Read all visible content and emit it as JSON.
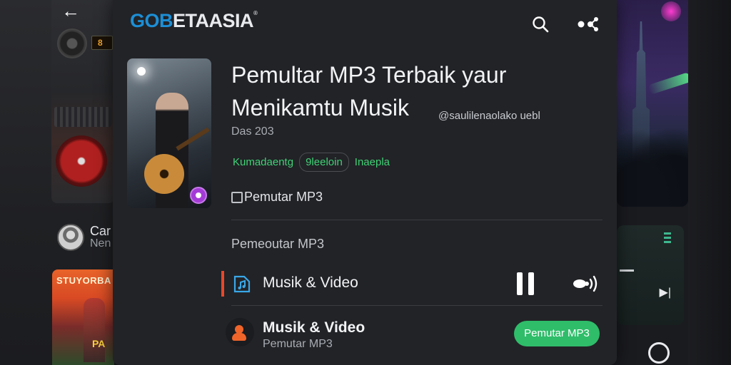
{
  "header": {
    "brand_part1": "GOB",
    "brand_part2": "ETAASIA",
    "brand_reg": "®"
  },
  "track": {
    "title_line1": "Pemultar MP3 Terbaik yaur",
    "title_line2": "Menikamtu Musik",
    "handle": "@saulilenaolako uebl",
    "date": "Das 203",
    "tags": [
      "Kumadaentg",
      "9leeloin",
      "Inaepla"
    ],
    "subtitle": "Pemutar MP3"
  },
  "section": {
    "label": "Pemeoutar MP3"
  },
  "now_playing": {
    "label": "Musik & Video",
    "state": "playing"
  },
  "list_item": {
    "title": "Musik & Video",
    "subtitle": "Pemutar MP3",
    "cta": "Pemutar MP3"
  },
  "left_preview": {
    "name": "Car",
    "sub": "Nen",
    "poster_title": "STUYORBA",
    "poster_badge": "PA"
  },
  "icons": {
    "back": "back-arrow-icon",
    "search": "search-icon",
    "share": "share-icon",
    "cover_badge": "sound-badge-icon",
    "doc": "document-icon",
    "music_video": "music-file-icon",
    "pause": "pause-icon",
    "cast": "cast-icon",
    "user": "user-icon"
  },
  "colors": {
    "brand_blue": "#1c8fd6",
    "accent_green": "#2fbd6a",
    "tag_green": "#3fd275",
    "active_accent": "#e8482a",
    "panel_bg": "#222327"
  }
}
